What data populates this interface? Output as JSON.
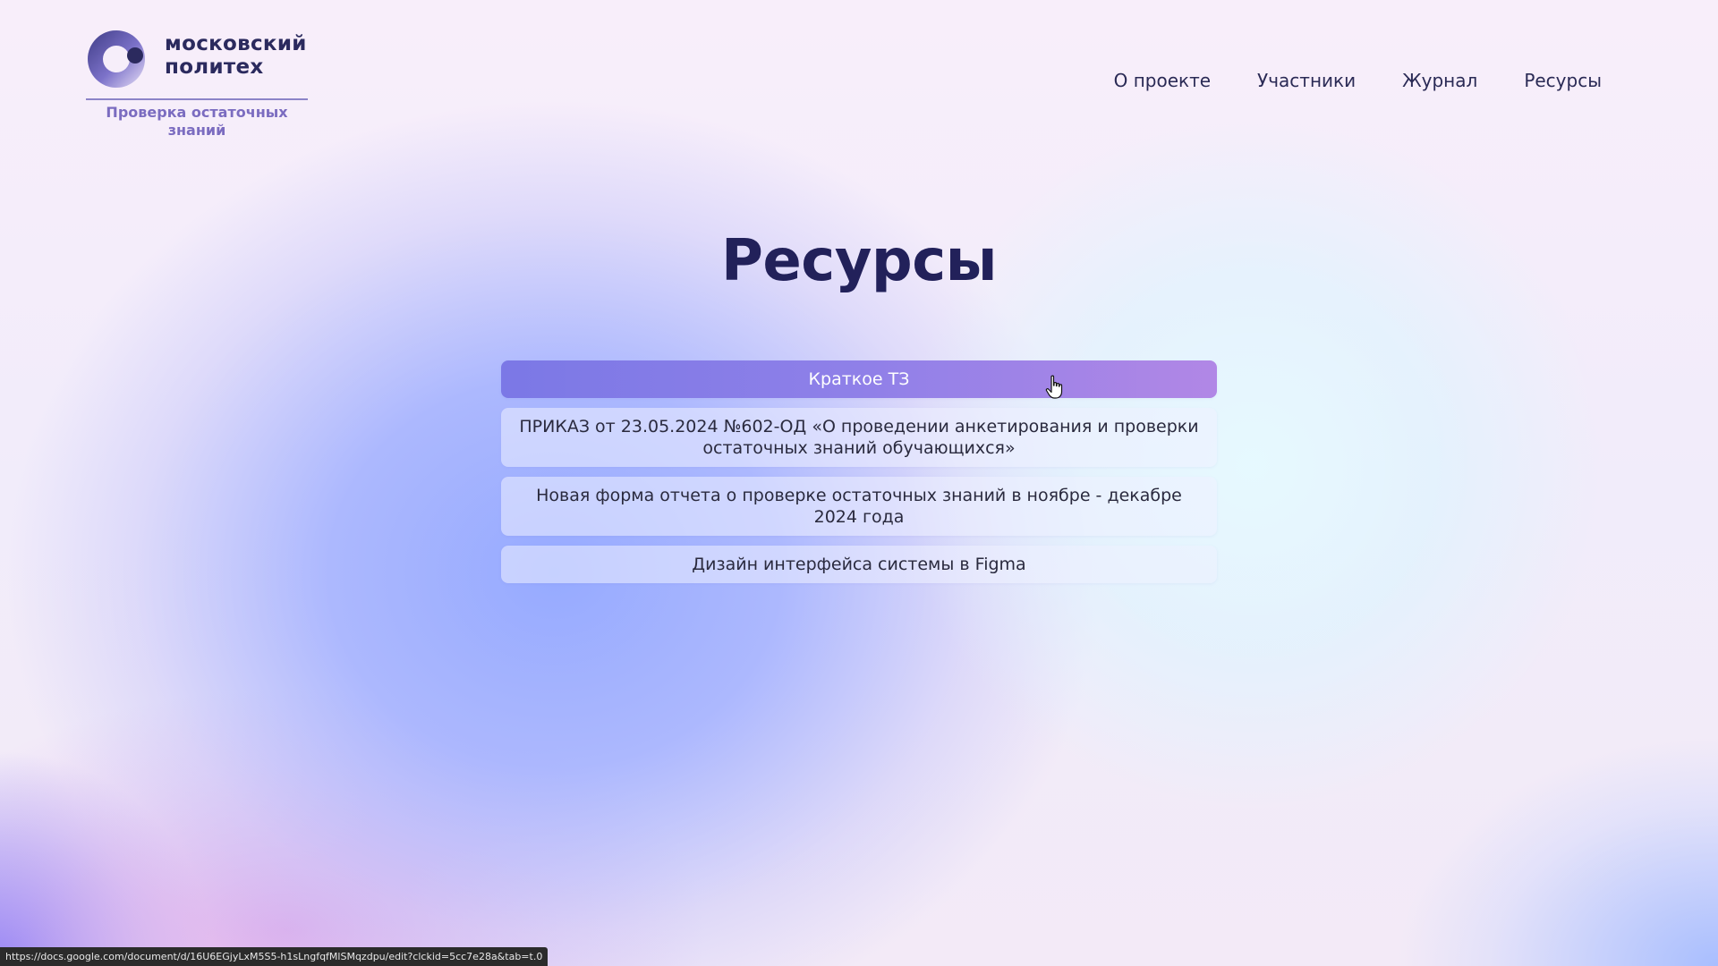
{
  "header": {
    "logo": {
      "name_line1": "московский",
      "name_line2": "политех",
      "subtitle": "Проверка остаточных знаний"
    },
    "nav": [
      {
        "label": "О проекте"
      },
      {
        "label": "Участники"
      },
      {
        "label": "Журнал"
      },
      {
        "label": "Ресурсы"
      }
    ]
  },
  "main": {
    "title": "Ресурсы",
    "resources": [
      {
        "label": "Краткое ТЗ",
        "state": "hovered"
      },
      {
        "label": "ПРИКАЗ от 23.05.2024 №602-ОД «О проведении анкетирования и проверки остаточных знаний обучающихся»"
      },
      {
        "label": "Новая форма отчета о проверке остаточных знаний в ноябре - декабре 2024 года"
      },
      {
        "label": "Дизайн интерфейса системы в Figma"
      }
    ]
  },
  "status_bar": {
    "url": "https://docs.google.com/document/d/16U6EGjyLxM5S5-h1sLngfqfMlSMqzdpu/edit?clckid=5cc7e28a&tab=t.0"
  },
  "colors": {
    "title": "#22215a",
    "active_button_start": "#7b78e6",
    "active_button_end": "#b187e6",
    "logo_subtitle": "#7b6cc0"
  },
  "icons": {
    "logo_mark": "polytech-logo-icon",
    "cursor": "hand-pointer-icon"
  }
}
